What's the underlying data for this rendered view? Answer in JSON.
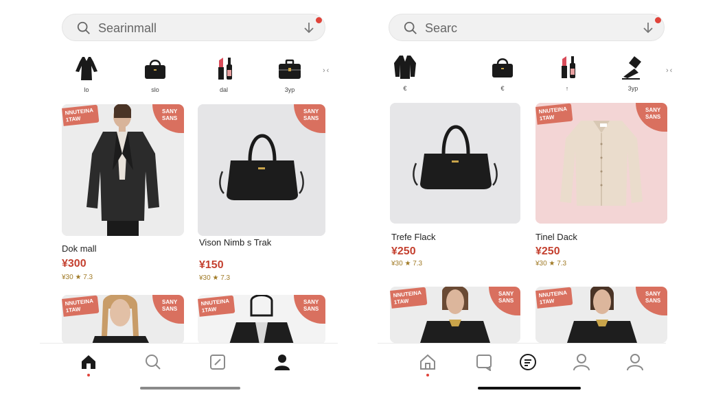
{
  "left": {
    "search": {
      "placeholder": "Searinmall"
    },
    "categories": [
      {
        "icon": "dress-icon",
        "label": "lo"
      },
      {
        "icon": "handbag-icon",
        "label": "slo"
      },
      {
        "icon": "cosmetics-icon",
        "label": "dal"
      },
      {
        "icon": "briefcase-icon",
        "label": "3yp"
      }
    ],
    "products": [
      {
        "tag_left": "NNUTEINA 1TAW",
        "tag_right": "Sany Sans",
        "name": "Dok mall",
        "price": "¥300",
        "rating": "¥30 ★ 7.3"
      },
      {
        "tag_left": "",
        "tag_right": "Sany Sans",
        "name": "Vison Nimb s Trak",
        "price": "¥150",
        "rating": "¥30 ★ 7.3"
      },
      {
        "tag_left": "NNUTEINA 1TAW",
        "tag_right": "Sany Sans"
      },
      {
        "tag_left": "NNUTEINA 1TAW",
        "tag_right": "Sany Sans"
      }
    ],
    "nav": [
      "home-icon",
      "search-icon",
      "edit-icon",
      "profile-icon"
    ]
  },
  "right": {
    "search": {
      "placeholder": "Searc"
    },
    "categories": [
      {
        "icon": "jacket-icon",
        "label": "€"
      },
      {
        "icon": "handbag-icon",
        "label": "€"
      },
      {
        "icon": "cosmetics-icon",
        "label": "↑"
      },
      {
        "icon": "pouring-icon",
        "label": "3yp"
      }
    ],
    "products": [
      {
        "tag_left": "",
        "tag_right": "",
        "name": "Trefe Flack",
        "price": "¥250",
        "rating": "¥30 ★ 7.3"
      },
      {
        "tag_left": "NNUTEINA 1TAW",
        "tag_right": "Sany Sans",
        "name": "Tinel Dack",
        "price": "¥250",
        "rating": "¥30 ★ 7.3"
      },
      {
        "tag_left": "NNUTEINA 1TAW",
        "tag_right": "Sany Sans"
      },
      {
        "tag_left": "NNUTEINA 1TAW",
        "tag_right": "Sany Sans"
      }
    ],
    "nav": [
      "home-icon",
      "chat-icon",
      "orders-icon",
      "account-icon",
      "profile-icon"
    ]
  },
  "colors": {
    "accent": "#c4402f",
    "tag": "#d9705f",
    "notification": "#e0433a"
  }
}
